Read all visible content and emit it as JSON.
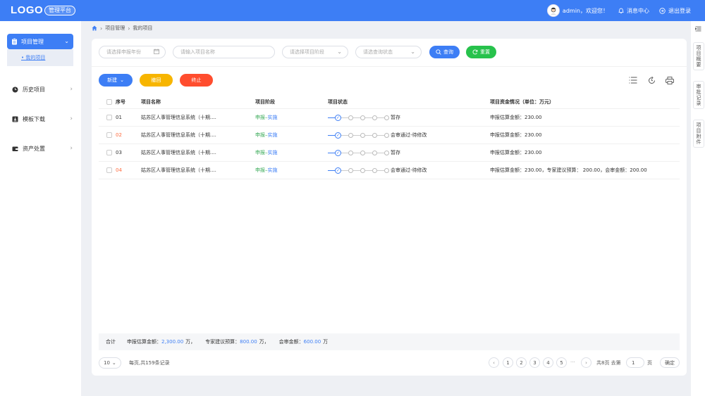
{
  "header": {
    "logo": "LOGO",
    "badge": "管理平台",
    "greeting": "admin，欢迎您！",
    "messages": "消息中心",
    "logout": "退出登录"
  },
  "sidebar": {
    "items": [
      {
        "label": "项目管理",
        "icon": "clipboard-icon",
        "active": true
      },
      {
        "label": "历史项目",
        "icon": "clock-icon"
      },
      {
        "label": "模板下载",
        "icon": "download-icon"
      },
      {
        "label": "资产处置",
        "icon": "wallet-icon"
      }
    ],
    "sub_item": "• 我的项目"
  },
  "breadcrumb": [
    "项目管理",
    "我的项目"
  ],
  "right_tabs": [
    "项目概要",
    "审批记录",
    "项目附件"
  ],
  "filters": {
    "year_placeholder": "请选择申报年份",
    "name_placeholder": "请输入项目名称",
    "stage_placeholder": "请选择项目阶段",
    "status_placeholder": "请选查询状态",
    "search_label": "查询",
    "reset_label": "重置"
  },
  "actions": {
    "new_label": "新建",
    "withdraw_label": "撤回",
    "terminate_label": "终止"
  },
  "table": {
    "headers": [
      "序号",
      "项目名称",
      "项目阶段",
      "项目状态",
      "项目资金情况（单位：万元）"
    ],
    "rows": [
      {
        "no": "01",
        "name": "姑苏区人事管理信息系统（十期....",
        "phase_a": "申报",
        "phase_b": "实施",
        "status": "暂存",
        "funds": "申报估算金额：230.00",
        "highlight": false
      },
      {
        "no": "02",
        "name": "姑苏区人事管理信息系统（十期....",
        "phase_a": "申报",
        "phase_b": "实施",
        "status": "会审通过-待修改",
        "funds": "申报估算金额：230.00",
        "highlight": true
      },
      {
        "no": "03",
        "name": "姑苏区人事管理信息系统（十期....",
        "phase_a": "申报",
        "phase_b": "实施",
        "status": "暂存",
        "funds": "申报估算金额：230.00",
        "highlight": false
      },
      {
        "no": "04",
        "name": "姑苏区人事管理信息系统（十期....",
        "phase_a": "申报",
        "phase_b": "实施",
        "status": "会审通过-待修改",
        "funds": "申报估算金额：230.00，专家建议预算： 200.00，会审金额：200.00",
        "highlight": true
      }
    ]
  },
  "summary": {
    "label": "合计",
    "est_label": "申报估算金额：",
    "est_value": "2,300.00",
    "unit": "万，",
    "expert_label": "专家建议预算：",
    "expert_value": "800.00",
    "review_label": "会审金额：",
    "review_value": "600.00",
    "unit_end": "万"
  },
  "pagination": {
    "page_size": "10",
    "info": "每页,共159条记录",
    "pages": [
      "1",
      "2",
      "3",
      "4",
      "5"
    ],
    "ellipsis": "···",
    "total_pages": "共8页 去第",
    "jump_value": "1",
    "page_unit": "页",
    "ok": "确定"
  },
  "colors": {
    "primary": "#3d7ef5",
    "warning": "#f7b500",
    "danger": "#ff4d2e",
    "success": "#27c24c",
    "highlight_no": "#ff6a3d"
  }
}
